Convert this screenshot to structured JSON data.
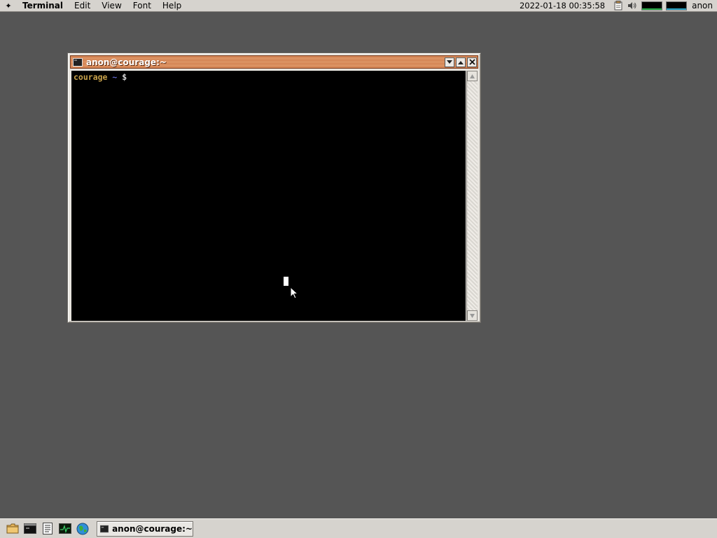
{
  "menubar": {
    "apple_icon": "star-icon",
    "items": [
      "Terminal",
      "Edit",
      "View",
      "Font",
      "Help"
    ],
    "clock": "2022-01-18 00:35:58",
    "tray_icons": [
      "clipboard-icon",
      "volume-icon"
    ],
    "meters": [
      {
        "name": "cpu-meter",
        "color": "#2bb24c"
      },
      {
        "name": "network-meter",
        "color": "#2aa7c9"
      }
    ],
    "user": "anon"
  },
  "window": {
    "title": "anon@courage:~",
    "icon": "terminal-icon",
    "controls": [
      "minimize",
      "maximize",
      "close"
    ],
    "terminal": {
      "prompt_host": "courage",
      "prompt_path": "~",
      "prompt_symbol": "$"
    }
  },
  "taskbar": {
    "launchers": [
      "folder-icon",
      "terminal-icon",
      "text-editor-icon",
      "system-monitor-icon",
      "web-browser-icon"
    ],
    "tasks": [
      {
        "label": "anon@courage:~",
        "icon": "terminal-icon"
      }
    ]
  }
}
